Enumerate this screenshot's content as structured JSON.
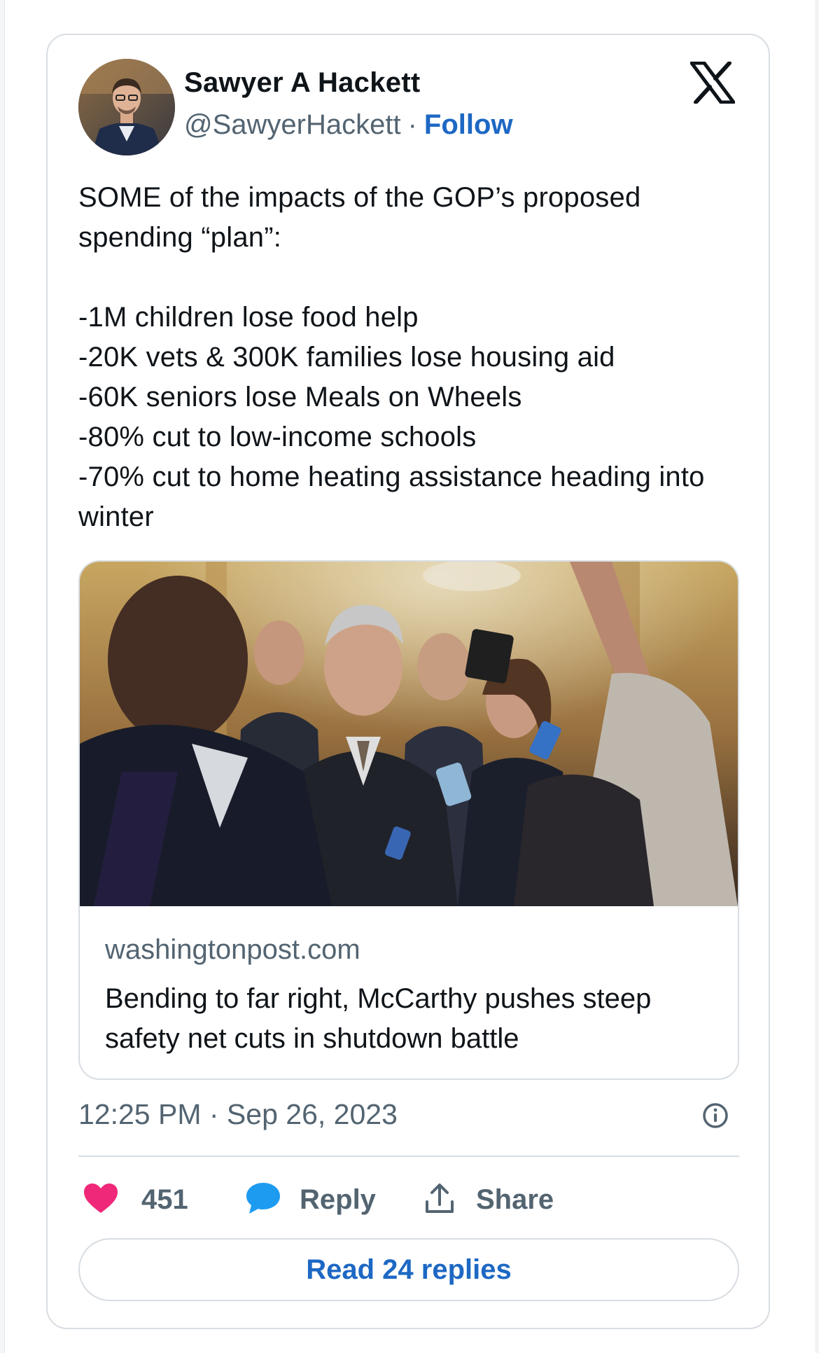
{
  "author": {
    "name": "Sawyer A Hackett",
    "handle": "@SawyerHackett",
    "separator": "·",
    "follow_label": "Follow",
    "avatar_icon": "profile-photo"
  },
  "brand": {
    "logo_icon": "x-logo"
  },
  "tweet": {
    "text": "SOME of the impacts of the GOP’s proposed spending “plan”:\n\n-1M children lose food help\n-20K vets & 300K families lose housing aid\n-60K seniors lose Meals on Wheels\n-80% cut to low-income schools\n-70% cut to home heating assistance heading into winter"
  },
  "link_card": {
    "image_icon": "news-photo",
    "domain": "washingtonpost.com",
    "title": "Bending to far right, McCarthy pushes steep safety net cuts in shutdown battle"
  },
  "meta": {
    "timestamp": "12:25 PM · Sep 26, 2023",
    "info_icon": "info-icon"
  },
  "actions": {
    "like_count": "451",
    "reply_label": "Reply",
    "share_label": "Share",
    "read_replies_label": "Read 24 replies"
  },
  "colors": {
    "accent": "#1d68c4",
    "like": "#f0287a",
    "reply_bubble": "#1d9bf0",
    "muted_text": "#536471",
    "border": "#d8dde2"
  }
}
